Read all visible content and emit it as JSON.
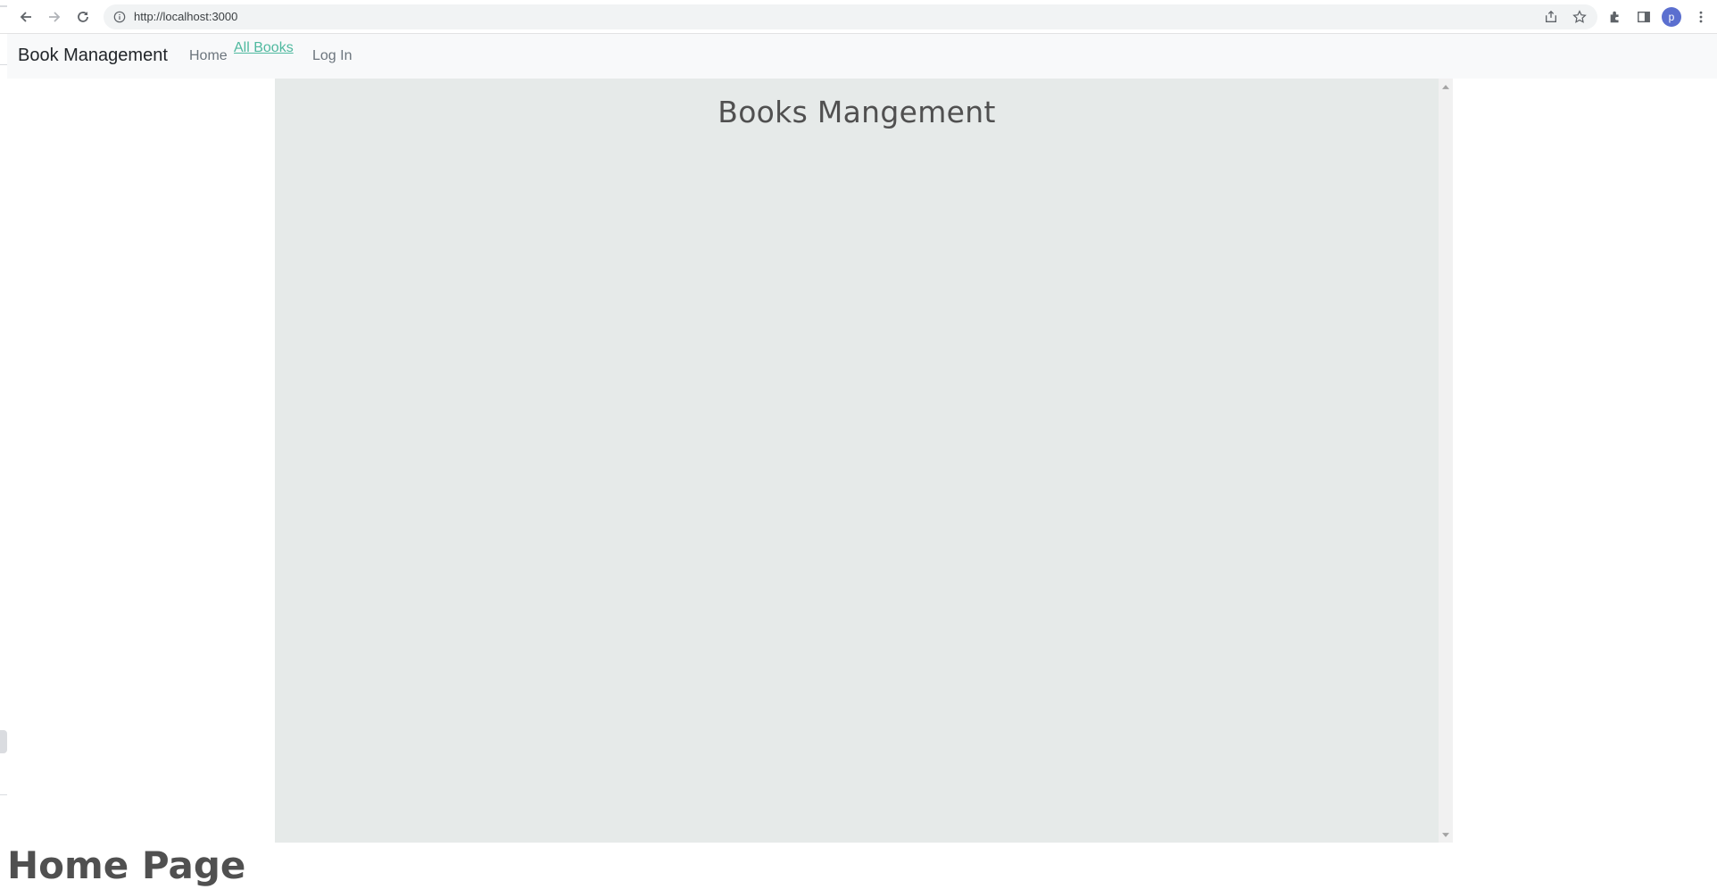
{
  "browser": {
    "url": "http://localhost:3000",
    "profile_initial": "p",
    "icons": [
      "back-icon",
      "forward-icon",
      "reload-icon",
      "info-icon",
      "share-icon",
      "star-icon",
      "extensions-icon",
      "side-panel-icon",
      "menu-icon"
    ]
  },
  "navbar": {
    "brand": "Book Management",
    "links": [
      {
        "label": "Home",
        "active": false
      },
      {
        "label": "All Books",
        "active": true
      },
      {
        "label": "Log In",
        "active": false
      }
    ],
    "active_color": "#4fb99f"
  },
  "frame": {
    "title": "Books Mangement",
    "background": "#e6eae9"
  },
  "page": {
    "heading": "Home Page"
  }
}
